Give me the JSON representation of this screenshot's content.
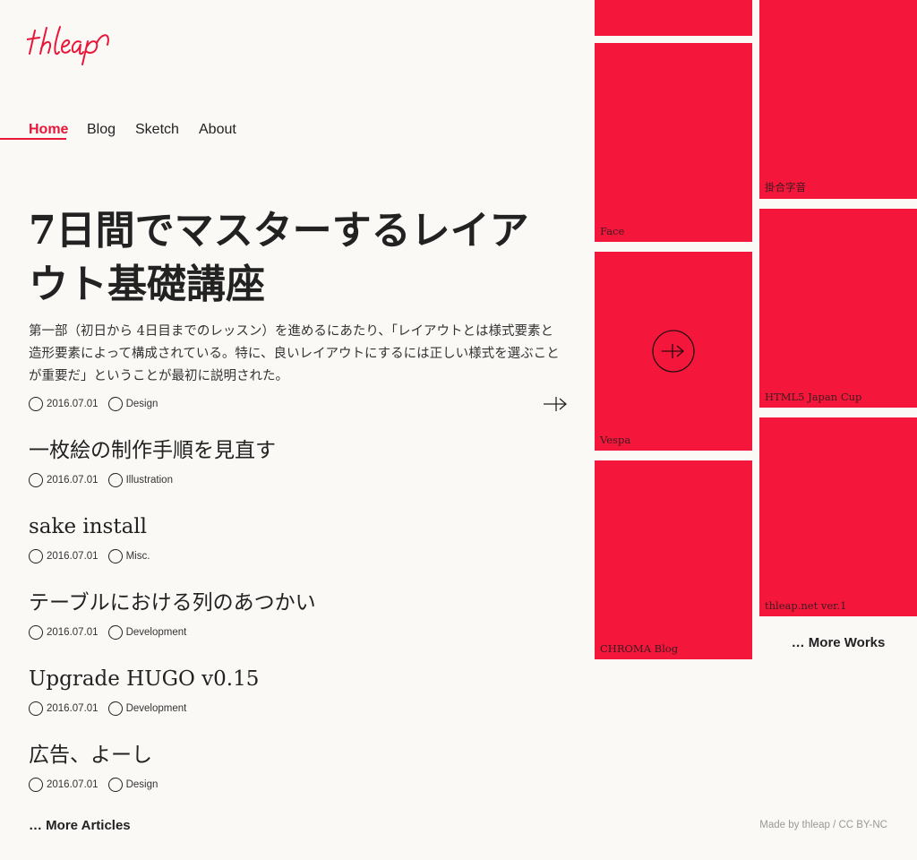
{
  "brand": {
    "logo_text": "thleap",
    "accent_color": "#e8173a",
    "tile_color": "#f5173b"
  },
  "nav": {
    "items": [
      {
        "label": "Home",
        "active": true
      },
      {
        "label": "Blog"
      },
      {
        "label": "Sketch"
      },
      {
        "label": "About"
      }
    ]
  },
  "featured": {
    "title": "7日間でマスターするレイアウト基礎講座",
    "description": "第一部（初日から 4日目までのレッスン）を進めるにあたり、「レイアウトとは様式要素と造形要素によって構成されている。特に、良いレイアウトにするには正しい様式を選ぶことが重要だ」ということが最初に説明された。",
    "date": "2016.07.01",
    "category": "Design",
    "arrow_icon": "arrow-right-icon"
  },
  "articles": [
    {
      "title": "一枚絵の制作手順を見直す",
      "date": "2016.07.01",
      "category": "Illustration"
    },
    {
      "title": "sake install",
      "date": "2016.07.01",
      "category": "Misc."
    },
    {
      "title": "テーブルにおける列のあつかい",
      "date": "2016.07.01",
      "category": "Development"
    },
    {
      "title": "Upgrade HUGO v0.15",
      "date": "2016.07.01",
      "category": "Development"
    },
    {
      "title": "広告、よーし",
      "date": "2016.07.01",
      "category": "Design"
    }
  ],
  "more_articles": "… More Articles",
  "works": {
    "left": [
      {
        "label": ""
      },
      {
        "label": "Face"
      },
      {
        "label": "Vespa",
        "icon": "arrow-circle-icon"
      },
      {
        "label": "CHROMA Blog"
      }
    ],
    "right": [
      {
        "label": "掛合字音"
      },
      {
        "label": "HTML5 Japan Cup"
      },
      {
        "label": "thleap.net ver.1"
      }
    ]
  },
  "more_works": "… More Works",
  "footer": {
    "credit": "Made by  thleap / CC BY-NC"
  }
}
